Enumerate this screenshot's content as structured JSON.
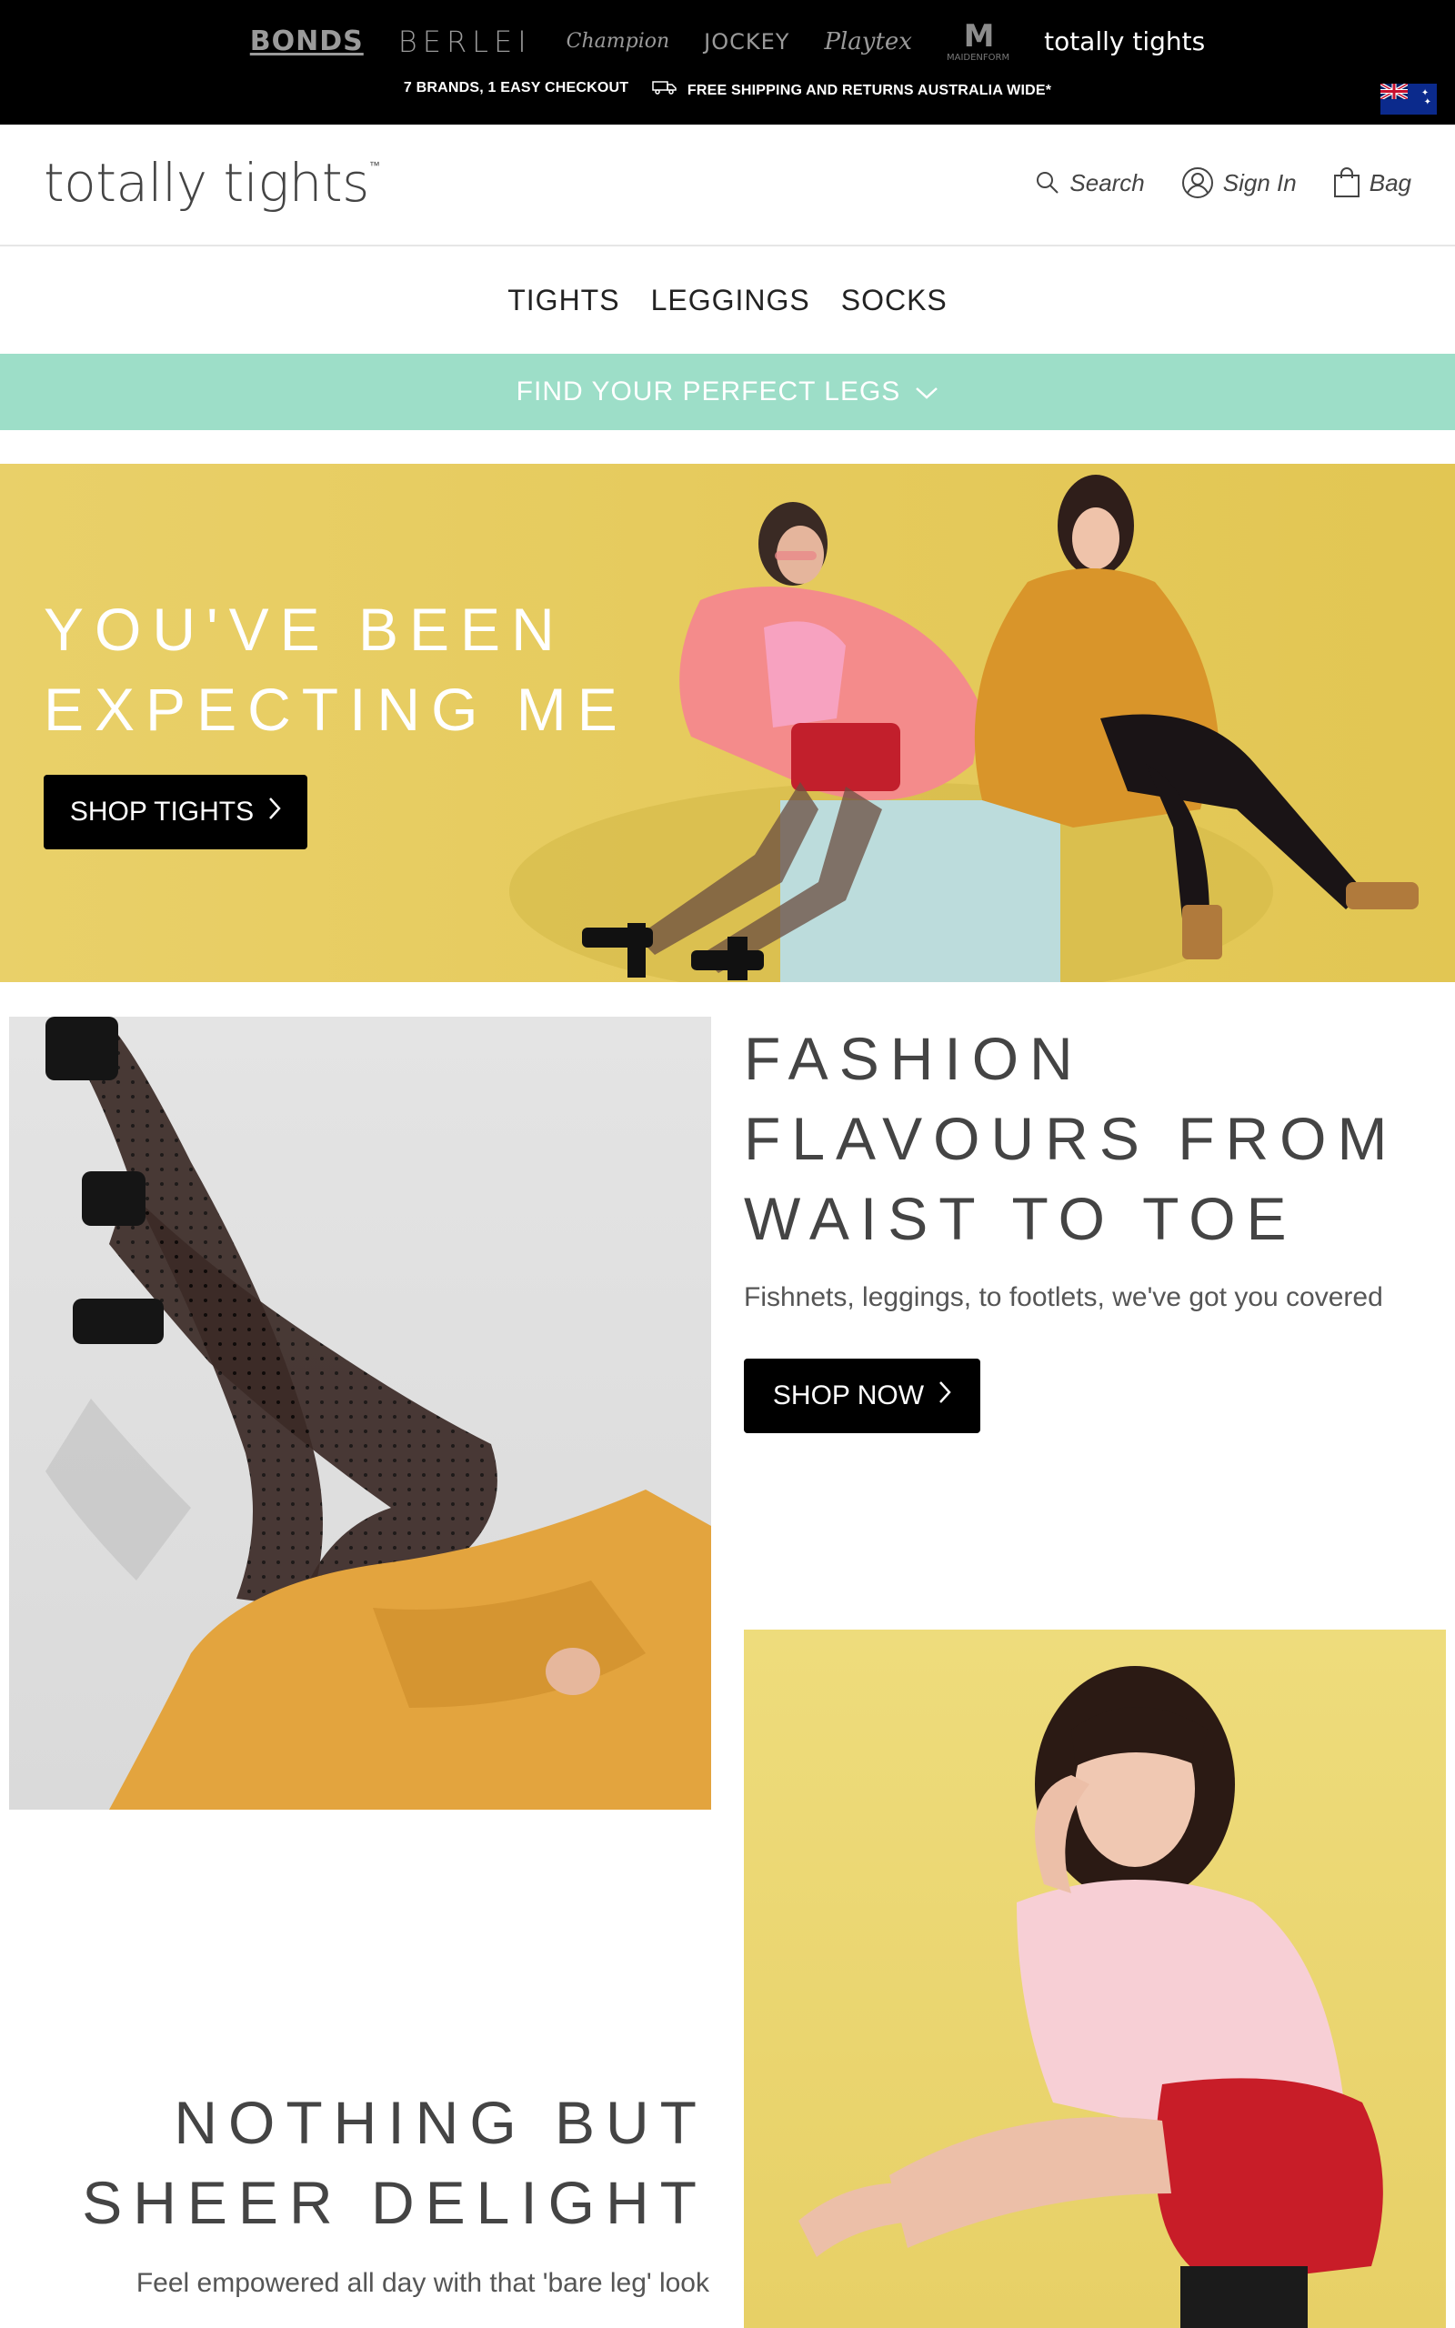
{
  "brandbar": {
    "brands": [
      "BONDS",
      "BERLEI",
      "Champion",
      "JOCKEY",
      "Playtex",
      "M",
      "MAIDENFORM",
      "totally tights"
    ],
    "promo_1": "7 BRANDS, 1 EASY CHECKOUT",
    "promo_2": "FREE SHIPPING AND RETURNS AUSTRALIA WIDE*",
    "country_flag": "australia-flag"
  },
  "header": {
    "logo": "totally tights",
    "logo_tm": "™",
    "search_label": "Search",
    "signin_label": "Sign In",
    "bag_label": "Bag"
  },
  "nav": {
    "items": [
      "TIGHTS",
      "LEGGINGS",
      "SOCKS"
    ]
  },
  "finder": {
    "label": "FIND YOUR PERFECT LEGS",
    "color": "#9ddec8"
  },
  "hero": {
    "title_line1": "YOU'VE BEEN",
    "title_line2": "EXPECTING ME",
    "button": "SHOP TIGHTS",
    "background": "#e6cb5e"
  },
  "section2": {
    "title_line1": "FASHION",
    "title_line2": "FLAVOURS FROM",
    "title_line3": "WAIST TO TOE",
    "subtitle": "Fishnets, leggings, to footlets, we've got you covered",
    "button": "SHOP NOW"
  },
  "section3": {
    "title_line1": "NOTHING BUT",
    "title_line2": "SHEER DELIGHT",
    "subtitle": "Feel empowered all day with that 'bare leg' look"
  }
}
